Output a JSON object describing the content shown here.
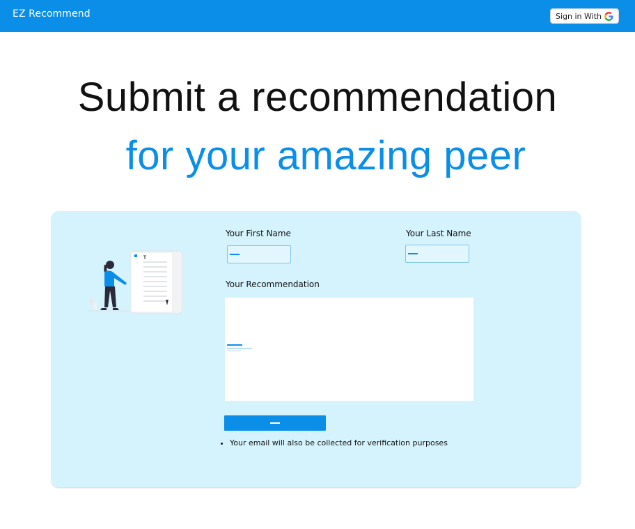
{
  "header": {
    "brand": "EZ Recommend",
    "signin_label": "Sign in With",
    "signin_icon": "google-g-icon"
  },
  "hero": {
    "line1": "Submit a recommendation",
    "line2": "for your amazing peer"
  },
  "form": {
    "first_name_label": "Your First Name",
    "first_name_value": "",
    "last_name_label": "Your Last Name",
    "last_name_value": "",
    "recommendation_label": "Your Recommendation",
    "recommendation_value": "",
    "submit_label": "",
    "note": "Your email will also be collected for verification purposes"
  },
  "colors": {
    "accent": "#0a8ee8",
    "card_bg": "#d5f3fd",
    "text": "#111111"
  }
}
